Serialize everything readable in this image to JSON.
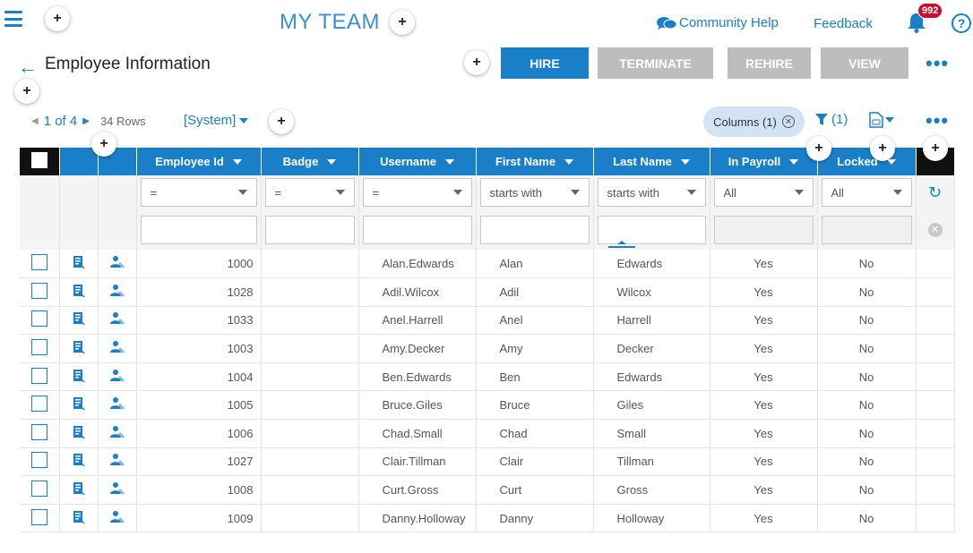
{
  "header": {
    "app_title": "MY TEAM",
    "community_help": "Community Help",
    "feedback": "Feedback",
    "notification_count": "992",
    "help_glyph": "?",
    "plus_glyph": "+"
  },
  "page": {
    "title": "Employee Information",
    "actions": {
      "hire": "HIRE",
      "terminate": "TERMINATE",
      "rehire": "REHIRE",
      "view": "VIEW"
    },
    "more": "•••"
  },
  "toolbar": {
    "page_indicator": "1 of 4",
    "row_count": "34 Rows",
    "view_name": "[System]",
    "columns_chip": "Columns (1)",
    "filter_count": "(1)"
  },
  "grid": {
    "columns": [
      "Employee Id",
      "Badge",
      "Username",
      "First Name",
      "Last Name",
      "In Payroll",
      "Locked"
    ],
    "filters": {
      "employee_id": "=",
      "badge": "=",
      "username": "=",
      "first_name": "starts with",
      "last_name": "starts with",
      "in_payroll": "All",
      "locked": "All"
    },
    "rows": [
      {
        "id": "1000",
        "badge": "",
        "username": "Alan.Edwards",
        "first": "Alan",
        "last": "Edwards",
        "payroll": "Yes",
        "locked": "No"
      },
      {
        "id": "1028",
        "badge": "",
        "username": "Adil.Wilcox",
        "first": "Adil",
        "last": "Wilcox",
        "payroll": "Yes",
        "locked": "No"
      },
      {
        "id": "1033",
        "badge": "",
        "username": "Anel.Harrell",
        "first": "Anel",
        "last": "Harrell",
        "payroll": "Yes",
        "locked": "No"
      },
      {
        "id": "1003",
        "badge": "",
        "username": "Amy.Decker",
        "first": "Amy",
        "last": "Decker",
        "payroll": "Yes",
        "locked": "No"
      },
      {
        "id": "1004",
        "badge": "",
        "username": "Ben.Edwards",
        "first": "Ben",
        "last": "Edwards",
        "payroll": "Yes",
        "locked": "No"
      },
      {
        "id": "1005",
        "badge": "",
        "username": "Bruce.Giles",
        "first": "Bruce",
        "last": "Giles",
        "payroll": "Yes",
        "locked": "No"
      },
      {
        "id": "1006",
        "badge": "",
        "username": "Chad.Small",
        "first": "Chad",
        "last": "Small",
        "payroll": "Yes",
        "locked": "No"
      },
      {
        "id": "1027",
        "badge": "",
        "username": "Clair.Tillman",
        "first": "Clair",
        "last": "Tillman",
        "payroll": "Yes",
        "locked": "No"
      },
      {
        "id": "1008",
        "badge": "",
        "username": "Curt.Gross",
        "first": "Curt",
        "last": "Gross",
        "payroll": "Yes",
        "locked": "No"
      },
      {
        "id": "1009",
        "badge": "",
        "username": "Danny.Holloway",
        "first": "Danny",
        "last": "Holloway",
        "payroll": "Yes",
        "locked": "No"
      }
    ]
  },
  "colors": {
    "primary": "#1a7fc9",
    "disabled_button": "#bdbdbd",
    "notification_badge": "#c8102e",
    "chip_bg": "#d2e3f3"
  }
}
